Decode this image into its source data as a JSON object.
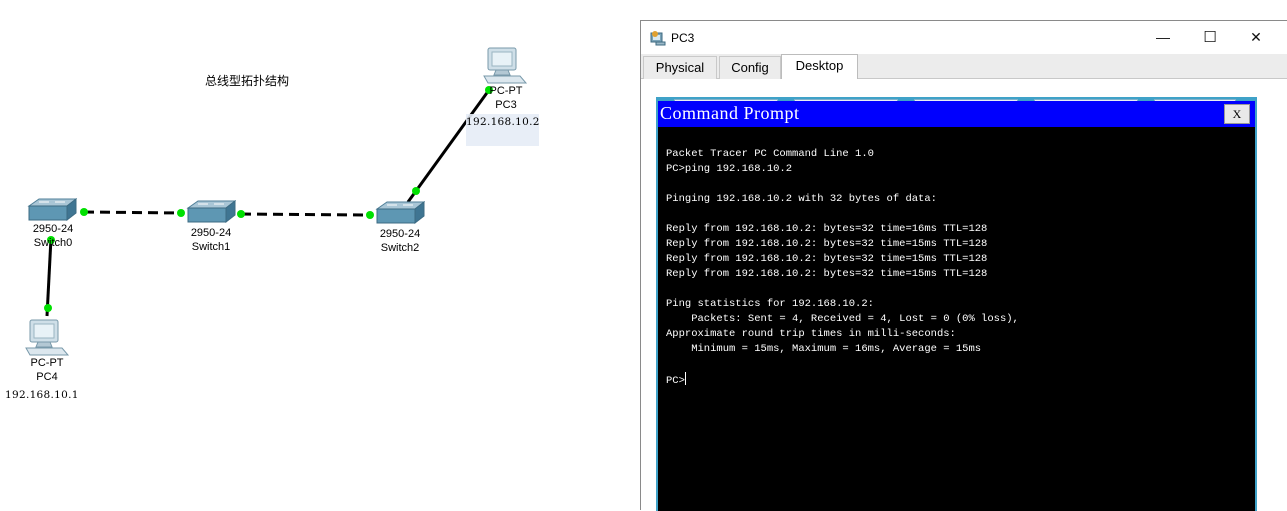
{
  "topology": {
    "title": "总线型拓扑结构",
    "devices": [
      {
        "model": "2950-24",
        "name": "Switch0"
      },
      {
        "model": "2950-24",
        "name": "Switch1"
      },
      {
        "model": "2950-24",
        "name": "Switch2"
      },
      {
        "model": "PC-PT",
        "name": "PC3",
        "ip": "192.168.10.2"
      },
      {
        "model": "PC-PT",
        "name": "PC4",
        "ip": "192.168.10.1"
      }
    ],
    "link_up_color": "#00e000"
  },
  "window": {
    "title": "PC3",
    "minimize": "—",
    "maximize": "☐",
    "close": "✕",
    "tabs": [
      {
        "label": "Physical"
      },
      {
        "label": "Config"
      },
      {
        "label": "Desktop"
      }
    ],
    "active_tab": "Desktop"
  },
  "command_prompt": {
    "title": "Command Prompt",
    "close_label": "X",
    "lines": [
      "Packet Tracer PC Command Line 1.0",
      "PC>ping 192.168.10.2",
      "",
      "Pinging 192.168.10.2 with 32 bytes of data:",
      "",
      "Reply from 192.168.10.2: bytes=32 time=16ms TTL=128",
      "Reply from 192.168.10.2: bytes=32 time=15ms TTL=128",
      "Reply from 192.168.10.2: bytes=32 time=15ms TTL=128",
      "Reply from 192.168.10.2: bytes=32 time=15ms TTL=128",
      "",
      "Ping statistics for 192.168.10.2:",
      "    Packets: Sent = 4, Received = 4, Lost = 0 (0% loss),",
      "Approximate round trip times in milli-seconds:",
      "    Minimum = 15ms, Maximum = 16ms, Average = 15ms",
      ""
    ],
    "prompt": "PC>"
  },
  "colors": {
    "cmd_title_bar": "#0000fe",
    "desktop_bg": "#3fa2c8",
    "terminal_bg": "#000000"
  }
}
